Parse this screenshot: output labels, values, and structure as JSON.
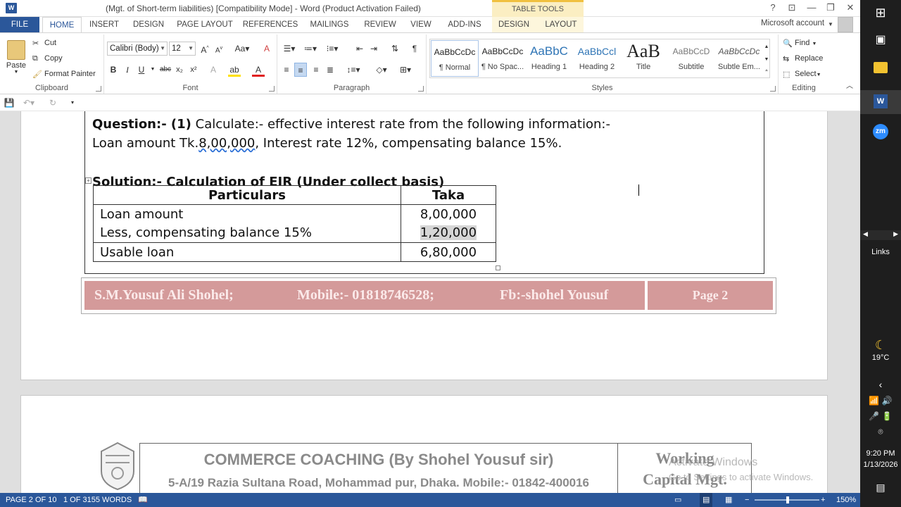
{
  "titlebar": {
    "doc_title": "(Mgt. of Short-term liabilities) [Compatibility Mode] - Word (Product Activation Failed)",
    "context_tab": "TABLE TOOLS",
    "help": "?",
    "minimize": "—",
    "restore": "❐",
    "close": "✕"
  },
  "tabs": {
    "file": "FILE",
    "items": [
      "HOME",
      "INSERT",
      "DESIGN",
      "PAGE LAYOUT",
      "REFERENCES",
      "MAILINGS",
      "REVIEW",
      "VIEW",
      "ADD-INS",
      "DESIGN",
      "LAYOUT"
    ],
    "account": "Microsoft account"
  },
  "ribbon": {
    "clipboard": {
      "paste": "Paste",
      "cut": "Cut",
      "copy": "Copy",
      "format_painter": "Format Painter",
      "label": "Clipboard"
    },
    "font": {
      "name": "Calibri (Body)",
      "size": "12",
      "label": "Font"
    },
    "paragraph": {
      "label": "Paragraph"
    },
    "styles": {
      "label": "Styles",
      "items": [
        {
          "preview": "AaBbCcDc",
          "name": "¶ Normal"
        },
        {
          "preview": "AaBbCcDc",
          "name": "¶ No Spac..."
        },
        {
          "preview": "AaBbC",
          "name": "Heading 1"
        },
        {
          "preview": "AaBbCcl",
          "name": "Heading 2"
        },
        {
          "preview": "AaB",
          "name": "Title"
        },
        {
          "preview": "AaBbCcD",
          "name": "Subtitle"
        },
        {
          "preview": "AaBbCcDc",
          "name": "Subtle Em..."
        }
      ]
    },
    "editing": {
      "find": "Find",
      "replace": "Replace",
      "select": "Select",
      "label": "Editing"
    }
  },
  "document": {
    "question_label": "Question:- (1)",
    "question_text": " Calculate:- effective interest rate from the following information:-",
    "loan_line_pre": "Loan amount Tk.",
    "loan_line_amount": "8,00,000",
    "loan_line_post": ", Interest rate 12%, compensating balance 15%.",
    "solution": "Solution:- Calculation of EIR (Under collect basis)",
    "table": {
      "headers": [
        "Particulars",
        "Taka"
      ],
      "rows": [
        [
          "Loan amount",
          "8,00,000"
        ],
        [
          "Less, compensating balance 15%",
          "1,20,000"
        ],
        [
          "Usable loan",
          "6,80,000"
        ]
      ]
    },
    "footer": {
      "name": "S.M.Yousuf Ali Shohel;",
      "mobile": "Mobile:- 01818746528;",
      "fb": "Fb:-shohel Yousuf",
      "page": "Page 2"
    },
    "header2": {
      "title": "COMMERCE COACHING (By Shohel Yousuf sir)",
      "address": "5-A/19 Razia Sultana Road, Mohammad pur, Dhaka. Mobile:- 01842-400016",
      "side_line1": "Working",
      "side_line2": "Capital Mgt."
    }
  },
  "watermark": {
    "line1": "Activate Windows",
    "line2": "Go to Settings to activate Windows."
  },
  "statusbar": {
    "page": "PAGE 2 OF 10",
    "words": "1 OF 3155 WORDS",
    "zoom": "150%"
  },
  "taskbar": {
    "weather": "19°C",
    "time": "9:20 PM",
    "date": "1/13/2026",
    "links": "Links",
    "zoom_app": "zm"
  }
}
